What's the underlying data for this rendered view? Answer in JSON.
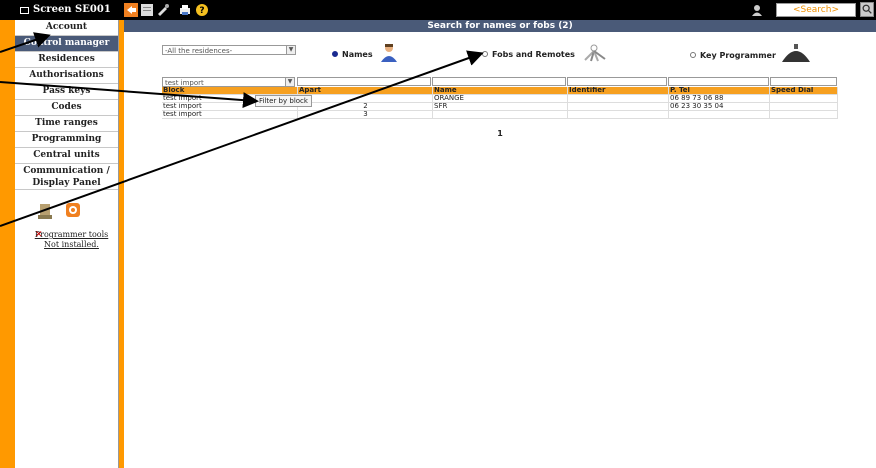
{
  "toolbar": {
    "screen_label": "Screen SE001",
    "search_placeholder": "<Search>"
  },
  "sidebar": {
    "items": [
      {
        "label": "Account"
      },
      {
        "label": "Control manager"
      },
      {
        "label": "Residences"
      },
      {
        "label": "Authorisations"
      },
      {
        "label": "Pass keys"
      },
      {
        "label": "Codes"
      },
      {
        "label": "Time ranges"
      },
      {
        "label": "Programming"
      },
      {
        "label": "Central units"
      },
      {
        "label": "Communication / Display Panel"
      }
    ],
    "programmer_tools_line1": "Programmer tools",
    "programmer_tools_line2": "Not installed."
  },
  "main": {
    "title": "Search for names or fobs (2)",
    "residence_select": "-All the residences-",
    "options": [
      {
        "label": "Names",
        "checked": true
      },
      {
        "label": "Fobs and Remotes",
        "checked": false
      },
      {
        "label": "Key Programmer",
        "checked": false
      }
    ],
    "block_filter_value": "test import",
    "tooltip": "Filter by block",
    "columns": [
      "Block",
      "Apart",
      "Name",
      "Identifier",
      "P. Tel",
      "Speed Dial"
    ],
    "rows": [
      [
        "test import",
        "",
        "ORANGE",
        "",
        "06 89 73 06 88",
        ""
      ],
      [
        "test import",
        "2",
        "SFR",
        "",
        "06 23 30 35 04",
        ""
      ],
      [
        "test import",
        "3",
        "",
        "",
        "",
        ""
      ]
    ],
    "page": "1"
  },
  "colors": {
    "orange_background": "#ff9900",
    "header_blue": "#4a5a78",
    "table_header_orange": "#f6a020"
  }
}
